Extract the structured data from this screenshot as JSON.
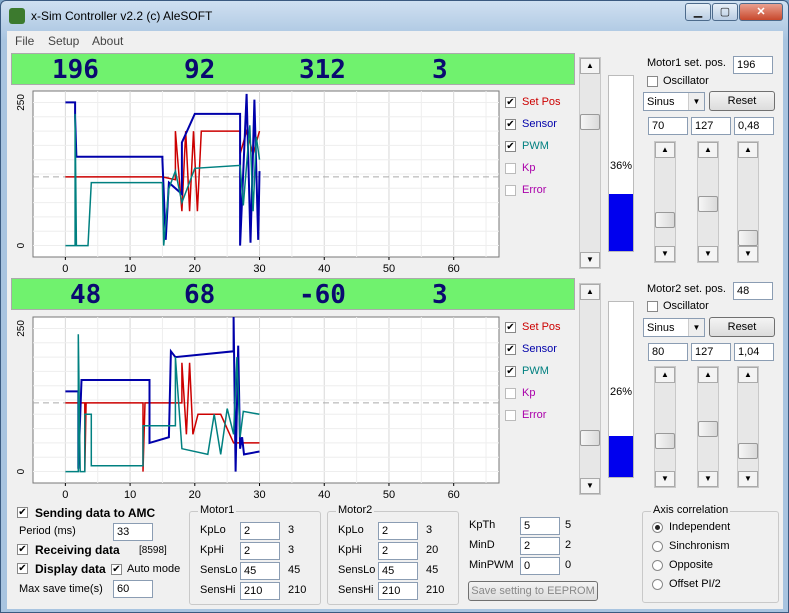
{
  "window": {
    "title": "x-Sim Controller v2.2 (c) AleSOFT"
  },
  "menu": [
    "File",
    "Setup",
    "About"
  ],
  "panels": [
    {
      "band": [
        "196",
        "92",
        "312",
        "3"
      ],
      "legend": [
        {
          "label": "Set Pos",
          "checked": true,
          "color": "#cc0000"
        },
        {
          "label": "Sensor",
          "checked": true,
          "color": "#0000aa"
        },
        {
          "label": "PWM",
          "checked": true,
          "color": "#008080"
        },
        {
          "label": "Kp",
          "checked": false,
          "color": "#aa00aa"
        },
        {
          "label": "Error",
          "checked": false,
          "color": "#aa00aa"
        }
      ],
      "gauge_percent": 36,
      "gauge_text": "36%",
      "motor_label": "Motor1 set. pos.",
      "motor_value": "196",
      "oscillator_label": "Oscillator",
      "wave": "Sinus",
      "reset_label": "Reset",
      "params": [
        "70",
        "127",
        "0,48"
      ]
    },
    {
      "band": [
        "48",
        "68",
        "-60",
        "3"
      ],
      "legend": [
        {
          "label": "Set Pos",
          "checked": true,
          "color": "#cc0000"
        },
        {
          "label": "Sensor",
          "checked": true,
          "color": "#0000aa"
        },
        {
          "label": "PWM",
          "checked": true,
          "color": "#008080"
        },
        {
          "label": "Kp",
          "checked": false,
          "color": "#aa00aa"
        },
        {
          "label": "Error",
          "checked": false,
          "color": "#aa00aa"
        }
      ],
      "gauge_percent": 26,
      "gauge_text": "26%",
      "motor_label": "Motor2 set. pos.",
      "motor_value": "48",
      "oscillator_label": "Oscillator",
      "wave": "Sinus",
      "reset_label": "Reset",
      "params": [
        "80",
        "127",
        "1,04"
      ]
    }
  ],
  "chart_data": [
    {
      "type": "line",
      "xlim": [
        -5,
        67
      ],
      "ylim": [
        -20,
        270
      ],
      "xticks": [
        "0",
        "10",
        "20",
        "30",
        "40",
        "50",
        "60"
      ],
      "yticks": [
        "0",
        "250"
      ],
      "ref_line": 120,
      "series": [
        {
          "name": "Set Pos",
          "color": "#cc0000",
          "points": [
            [
              0,
              120
            ],
            [
              15,
              120
            ],
            [
              15,
              120
            ],
            [
              17,
              115
            ],
            [
              17,
              200
            ],
            [
              18,
              60
            ],
            [
              18.6,
              200
            ],
            [
              19.2,
              60
            ],
            [
              19.8,
              200
            ],
            [
              20.4,
              60
            ],
            [
              21,
              200
            ],
            [
              27,
              200
            ],
            [
              27,
              160
            ],
            [
              28,
              200
            ],
            [
              29,
              160
            ],
            [
              30,
              200
            ]
          ]
        },
        {
          "name": "Sensor",
          "color": "#0000aa",
          "points": [
            [
              0,
              250
            ],
            [
              1.5,
              250
            ],
            [
              1.5,
              225
            ],
            [
              1.7,
              155
            ],
            [
              2.3,
              155
            ],
            [
              15,
              155
            ],
            [
              15,
              150
            ],
            [
              15.5,
              10
            ],
            [
              16,
              110
            ],
            [
              18,
              90
            ],
            [
              18,
              180
            ],
            [
              20,
              230
            ],
            [
              27,
              230
            ],
            [
              27,
              0
            ],
            [
              28,
              265
            ],
            [
              28.6,
              5
            ],
            [
              29.2,
              255
            ],
            [
              29.8,
              10
            ],
            [
              30,
              130
            ]
          ]
        },
        {
          "name": "PWM",
          "color": "#008080",
          "points": [
            [
              0,
              0
            ],
            [
              1.5,
              0
            ],
            [
              1.5,
              230
            ],
            [
              1.7,
              0
            ],
            [
              3.5,
              0
            ],
            [
              4,
              110
            ],
            [
              15,
              110
            ],
            [
              15.2,
              0
            ],
            [
              16,
              100
            ],
            [
              17,
              130
            ],
            [
              18,
              75
            ],
            [
              20,
              135
            ],
            [
              27,
              140
            ],
            [
              27.5,
              70
            ],
            [
              28.5,
              210
            ],
            [
              29,
              60
            ],
            [
              29.5,
              190
            ],
            [
              30,
              150
            ]
          ]
        }
      ]
    },
    {
      "type": "line",
      "xlim": [
        -5,
        67
      ],
      "ylim": [
        -20,
        270
      ],
      "xticks": [
        "0",
        "10",
        "20",
        "30",
        "40",
        "50",
        "60"
      ],
      "yticks": [
        "0",
        "250"
      ],
      "ref_line": 120,
      "series": [
        {
          "name": "Set Pos",
          "color": "#cc0000",
          "points": [
            [
              0,
              120
            ],
            [
              3,
              120
            ],
            [
              3,
              0
            ],
            [
              3.2,
              120
            ],
            [
              12,
              120
            ],
            [
              12,
              0
            ],
            [
              12.3,
              120
            ],
            [
              18,
              120
            ],
            [
              18,
              190
            ],
            [
              18.7,
              65
            ],
            [
              19.2,
              190
            ],
            [
              19.7,
              65
            ],
            [
              20.5,
              100
            ],
            [
              24,
              100
            ],
            [
              26,
              50
            ],
            [
              30,
              50
            ]
          ]
        },
        {
          "name": "Sensor",
          "color": "#0000aa",
          "points": [
            [
              0,
              140
            ],
            [
              2,
              140
            ],
            [
              2,
              5
            ],
            [
              2.5,
              160
            ],
            [
              12,
              160
            ],
            [
              13,
              160
            ],
            [
              13,
              50
            ],
            [
              16,
              60
            ],
            [
              16.3,
              210
            ],
            [
              17,
              200
            ],
            [
              26,
              210
            ],
            [
              26,
              270
            ],
            [
              26.3,
              0
            ],
            [
              26.7,
              220
            ],
            [
              27,
              40
            ],
            [
              27.3,
              60
            ],
            [
              27.6,
              30
            ],
            [
              30,
              35
            ]
          ]
        },
        {
          "name": "PWM",
          "color": "#008080",
          "points": [
            [
              0,
              0
            ],
            [
              2,
              0
            ],
            [
              2,
              240
            ],
            [
              2.3,
              0
            ],
            [
              3,
              0
            ],
            [
              3,
              100
            ],
            [
              4,
              100
            ],
            [
              4,
              10
            ],
            [
              12,
              10
            ],
            [
              12,
              80
            ],
            [
              17,
              80
            ],
            [
              17,
              200
            ],
            [
              18,
              40
            ],
            [
              22,
              30
            ],
            [
              23,
              100
            ],
            [
              24,
              30
            ],
            [
              25,
              110
            ],
            [
              26,
              65
            ],
            [
              26.5,
              200
            ],
            [
              27,
              60
            ],
            [
              27.5,
              105
            ],
            [
              30,
              100
            ]
          ]
        }
      ]
    }
  ],
  "bottom": {
    "sending_label": "Sending data to AMC",
    "sending_checked": true,
    "period_label": "Period (ms)",
    "period_value": "33",
    "receiving_label": "Receiving data",
    "receiving_checked": true,
    "receiving_count": "[8598]",
    "display_label": "Display data",
    "display_checked": true,
    "auto_label": "Auto mode",
    "auto_checked": true,
    "maxsave_label": "Max save time(s)",
    "maxsave_value": "60",
    "motor1": {
      "title": "Motor1",
      "rows": [
        {
          "label": "KpLo",
          "input": "2",
          "value": "3"
        },
        {
          "label": "KpHi",
          "input": "2",
          "value": "3"
        },
        {
          "label": "SensLo",
          "input": "45",
          "value": "45"
        },
        {
          "label": "SensHi",
          "input": "210",
          "value": "210"
        }
      ]
    },
    "motor2": {
      "title": "Motor2",
      "rows": [
        {
          "label": "KpLo",
          "input": "2",
          "value": "3"
        },
        {
          "label": "KpHi",
          "input": "2",
          "value": "20"
        },
        {
          "label": "SensLo",
          "input": "45",
          "value": "45"
        },
        {
          "label": "SensHi",
          "input": "210",
          "value": "210"
        }
      ]
    },
    "misc": [
      {
        "label": "KpTh",
        "input": "5",
        "value": "5"
      },
      {
        "label": "MinD",
        "input": "2",
        "value": "2"
      },
      {
        "label": "MinPWM",
        "input": "0",
        "value": "0"
      }
    ],
    "eeprom_label": "Save setting to EEPROM",
    "axis": {
      "title": "Axis correlation",
      "options": [
        "Independent",
        "Sinchronism",
        "Opposite",
        "Offset PI/2"
      ],
      "selected": 0
    }
  }
}
